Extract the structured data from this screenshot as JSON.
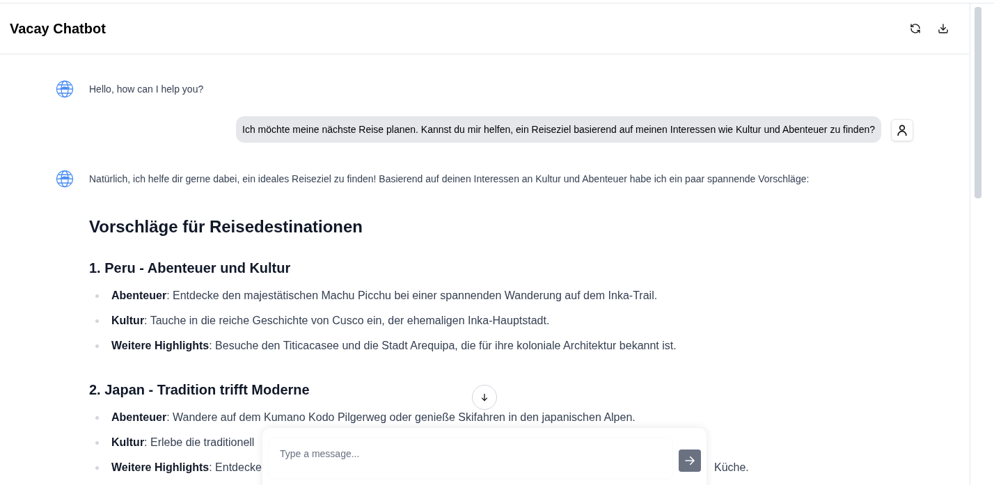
{
  "header": {
    "title": "Vacay Chatbot"
  },
  "messages": [
    {
      "kind": "bot",
      "text": "Hello, how can I help you?"
    },
    {
      "kind": "user",
      "text": "Ich möchte meine nächste Reise planen. Kannst du mir helfen, ein Reiseziel basierend auf meinen Interessen wie Kultur und Abenteuer zu finden?"
    },
    {
      "kind": "bot",
      "text": "Natürlich, ich helfe dir gerne dabei, ein ideales Reiseziel zu finden! Basierend auf deinen Interessen an Kultur und Abenteuer habe ich ein paar spannende Vorschläge:"
    }
  ],
  "answer": {
    "heading": "Vorschläge für Reisedestinationen",
    "sections": [
      {
        "title": "1. Peru - Abenteuer und Kultur",
        "items": [
          {
            "label": "Abenteuer",
            "text": ": Entdecke den majestätischen Machu Picchu bei einer spannenden Wanderung auf dem Inka-Trail."
          },
          {
            "label": "Kultur",
            "text": ": Tauche in die reiche Geschichte von Cusco ein, der ehemaligen Inka-Hauptstadt."
          },
          {
            "label": "Weitere Highlights",
            "text": ": Besuche den Titicacasee und die Stadt Arequipa, die für ihre koloniale Architektur bekannt ist."
          }
        ]
      },
      {
        "title": "2. Japan - Tradition trifft Moderne",
        "items": [
          {
            "label": "Abenteuer",
            "text": ": Wandere auf dem Kumano Kodo Pilgerweg oder genieße Skifahren in den japanischen Alpen."
          },
          {
            "label": "Kultur",
            "text": ": Erlebe die traditionell"
          },
          {
            "label": "Weitere Highlights",
            "text": ": Entdecke",
            "text_end": "Küche."
          }
        ]
      }
    ]
  },
  "composer": {
    "placeholder": "Type a message..."
  }
}
